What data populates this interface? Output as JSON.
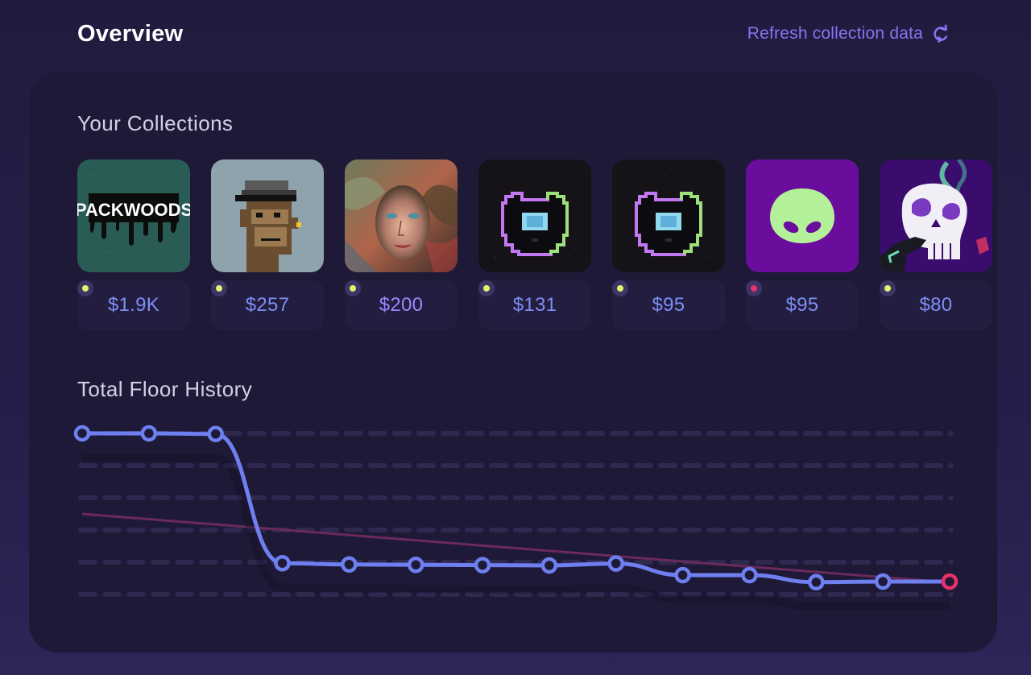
{
  "header": {
    "title": "Overview",
    "refresh_label": "Refresh collection data",
    "accent_color": "#8b72ee"
  },
  "collections": {
    "title": "Your Collections",
    "items": [
      {
        "price": "$1.9K",
        "status_color": "#e6f26b",
        "image": "packwoods-logo"
      },
      {
        "price": "$257",
        "status_color": "#e6f26b",
        "image": "pixel-ape"
      },
      {
        "price": "$200",
        "status_color": "#e6f26b",
        "image": "painted-portrait"
      },
      {
        "price": "$131",
        "status_color": "#e6f26b",
        "image": "pixel-bear"
      },
      {
        "price": "$95",
        "status_color": "#e6f26b",
        "image": "pixel-bear"
      },
      {
        "price": "$95",
        "status_color": "#e8306a",
        "image": "alien-head"
      },
      {
        "price": "$80",
        "status_color": "#e6f26b",
        "image": "skull"
      }
    ]
  },
  "chart": {
    "title": "Total Floor History",
    "chart_data": {
      "type": "line",
      "title": "Total Floor History",
      "xlabel": "",
      "ylabel": "",
      "grid": true,
      "series": [
        {
          "values": [
            100,
            100,
            99.6,
            19.4,
            18.6,
            18.4,
            18.2,
            18.0,
            19.2,
            12.0,
            12.0,
            7.6,
            8.0,
            8.0
          ],
          "color": "#6e7ff0"
        },
        {
          "values": [
            50,
            7.4
          ],
          "color": "#6a2a5c",
          "kind": "trend"
        }
      ],
      "ylim": [
        0,
        100
      ]
    }
  }
}
